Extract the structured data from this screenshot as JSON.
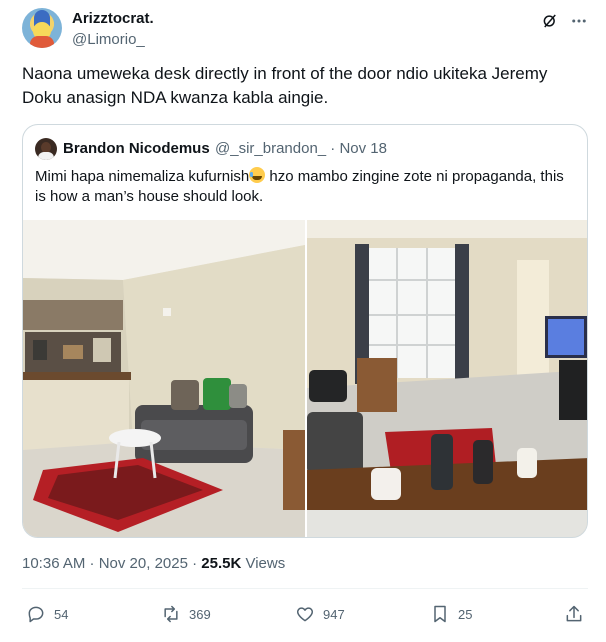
{
  "author": {
    "name": "Arizztocrat.",
    "handle": "@Limorio_"
  },
  "tweet": {
    "text": "Naona umeweka desk directly in front of the door ndio ukiteka Jeremy Doku anasign NDA kwanza kabla aingie."
  },
  "quote": {
    "name": "Brandon Nicodemus",
    "handle": "@_sir_brandon_ · Nov 18",
    "text_before": "Mimi hapa nimemaliza kufurnish",
    "text_after": " hzo mambo zingine zote ni propaganda, this is how a man’s house should look."
  },
  "meta": {
    "time": "10:36 AM · Nov 20, 2025 · ",
    "views_count": "25.5K",
    "views_label": " Views"
  },
  "actions": {
    "replies": "54",
    "reposts": "369",
    "likes": "947",
    "bookmarks": "25"
  },
  "icons": [
    "grok-icon",
    "more-icon",
    "reply-icon",
    "repost-icon",
    "like-icon",
    "bookmark-icon",
    "share-icon"
  ],
  "colors": {
    "text": "#0f1419",
    "secondary": "#536471",
    "border": "#cfd9de"
  }
}
